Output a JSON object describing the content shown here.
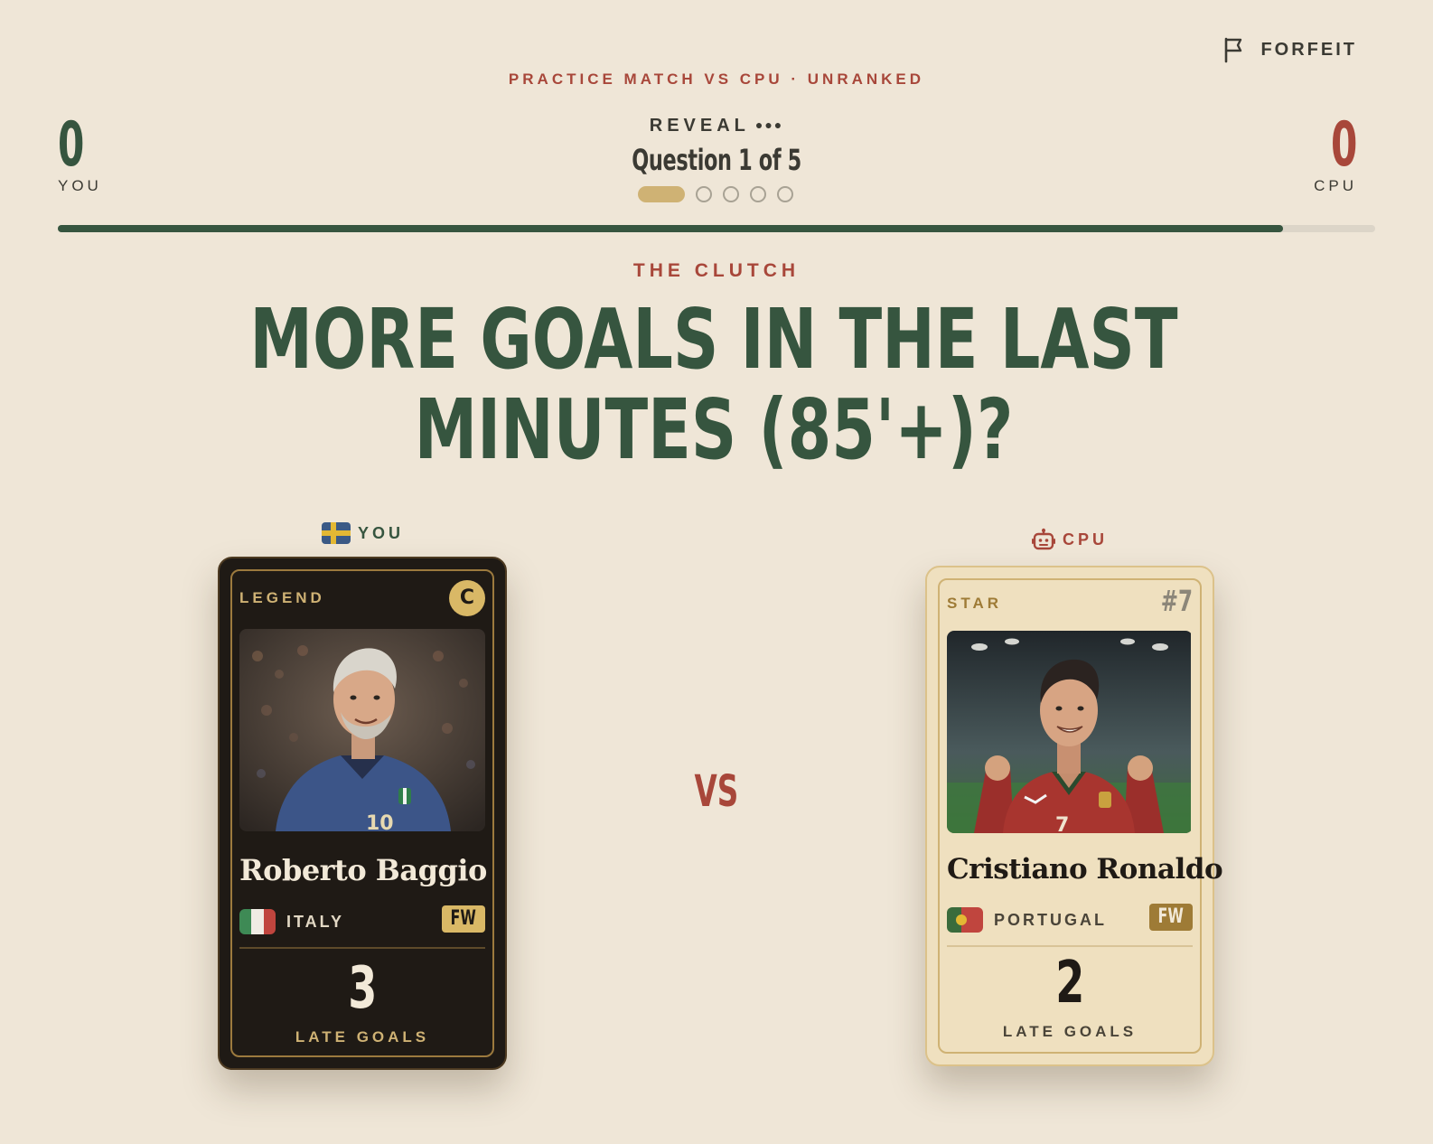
{
  "header": {
    "forfeit_label": "FORFEIT",
    "match_subtitle": "PRACTICE MATCH VS CPU · UNRANKED",
    "phase_label": "REVEAL",
    "phase_dots": "●●●",
    "question_counter": "Question 1 of 5",
    "question_index": 1,
    "question_total": 5,
    "timer_remaining_fraction": 0.93
  },
  "scores": {
    "you": {
      "value": "0",
      "label": "YOU"
    },
    "cpu": {
      "value": "0",
      "label": "CPU"
    }
  },
  "question": {
    "category": "THE CLUTCH",
    "text": "MORE GOALS IN THE LAST MINUTES (85'+)?"
  },
  "vs_label": "VS",
  "cards": {
    "you": {
      "owner_label": "YOU",
      "owner_icon": "sweden-flag-icon",
      "tier": "LEGEND",
      "badge": "C",
      "name": "Roberto Baggio",
      "nation": "ITALY",
      "position": "FW",
      "stat_value": "3",
      "stat_label": "LATE GOALS",
      "theme_color": "#1f1a15",
      "accent_color": "#cfb274"
    },
    "cpu": {
      "owner_label": "CPU",
      "owner_icon": "robot-icon",
      "tier": "STAR",
      "badge": "#7",
      "name": "Cristiano Ronaldo",
      "nation": "PORTUGAL",
      "position": "FW",
      "stat_value": "2",
      "stat_label": "LATE GOALS",
      "theme_color": "#efe0bf",
      "accent_color": "#9e7b36"
    }
  },
  "colors": {
    "background": "#efe6d7",
    "green": "#36553f",
    "red": "#a8473a",
    "gold": "#cfb274"
  }
}
